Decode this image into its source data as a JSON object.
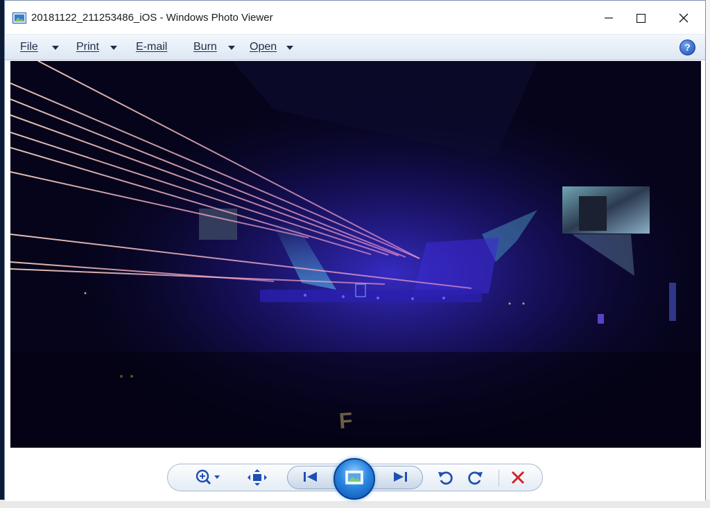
{
  "window": {
    "title": "20181122_211253486_iOS - Windows Photo Viewer",
    "icon": "photo-viewer-icon"
  },
  "window_controls": {
    "minimize": "minimize-icon",
    "maximize": "maximize-icon",
    "close": "close-icon"
  },
  "menubar": {
    "items": [
      {
        "label": "File",
        "has_dropdown": true
      },
      {
        "label": "Print",
        "has_dropdown": true
      },
      {
        "label": "E-mail",
        "has_dropdown": false
      },
      {
        "label": "Burn",
        "has_dropdown": true
      },
      {
        "label": "Open",
        "has_dropdown": true
      }
    ],
    "help_icon": "help-icon",
    "help_glyph": "?"
  },
  "photo": {
    "description_icon": "concert-photo-image"
  },
  "toolbar": {
    "buttons": [
      {
        "name": "zoom",
        "icon": "zoom-icon"
      },
      {
        "name": "actual-size",
        "icon": "fit-to-window-icon"
      },
      {
        "name": "previous",
        "icon": "previous-icon"
      },
      {
        "name": "slideshow",
        "icon": "slideshow-icon"
      },
      {
        "name": "next",
        "icon": "next-icon"
      },
      {
        "name": "rotate-ccw",
        "icon": "rotate-counterclockwise-icon"
      },
      {
        "name": "rotate-cw",
        "icon": "rotate-clockwise-icon"
      },
      {
        "name": "delete",
        "icon": "delete-icon"
      }
    ]
  },
  "colors": {
    "accent": "#1e4fb4",
    "delete": "#d4202a",
    "menubar_text": "#1c2d4a"
  }
}
